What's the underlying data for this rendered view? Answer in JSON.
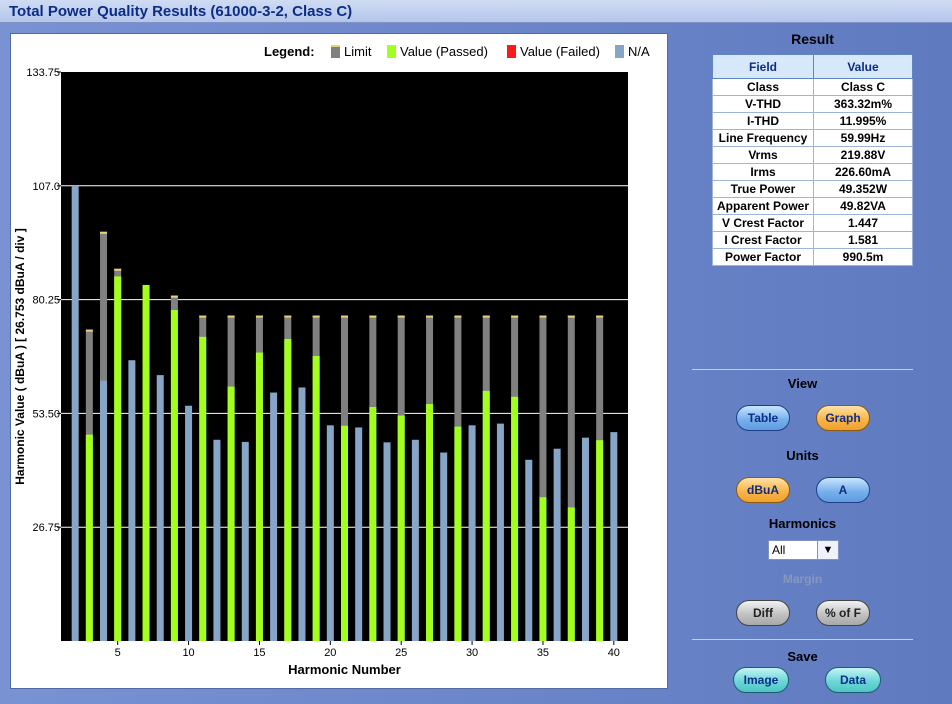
{
  "window": {
    "title": "Total Power Quality Results (61000-3-2, Class C)"
  },
  "chart_data": {
    "type": "bar",
    "title": "",
    "xlabel": "Harmonic Number",
    "ylabel": "Harmonic Value ( dBuA ) [ 26.753 dBuA / div ]",
    "ylim": [
      0,
      133.75
    ],
    "yticks": [
      26.75,
      53.5,
      80.25,
      107.0,
      133.75
    ],
    "ytick_labels": [
      "26.75",
      "53.50",
      "80.25",
      "107.0",
      "133.75"
    ],
    "xticks": [
      5,
      10,
      15,
      20,
      25,
      30,
      35,
      40
    ],
    "xlim": [
      1,
      41
    ],
    "grid": "horizontal",
    "legend_position": "top",
    "legend": {
      "title": "Legend:",
      "items": [
        {
          "name": "Limit",
          "color": "#808080"
        },
        {
          "name": "Value (Passed)",
          "color": "#a3ff1e"
        },
        {
          "name": "Value (Failed)",
          "color": "#ff1a1a"
        },
        {
          "name": "N/A",
          "color": "#87a6c7"
        }
      ]
    },
    "series": [
      {
        "name": "Limit",
        "x": [
          3,
          4,
          5,
          6,
          7,
          8,
          9,
          10,
          11,
          12,
          13,
          14,
          15,
          16,
          17,
          18,
          19,
          20,
          21,
          22,
          23,
          24,
          25,
          26,
          27,
          28,
          29,
          30,
          31,
          32,
          33,
          34,
          35,
          36,
          37,
          38,
          39,
          40
        ],
        "values": [
          73.2,
          96.2,
          87.5,
          null,
          null,
          null,
          81.2,
          null,
          76.5,
          null,
          76.5,
          null,
          76.5,
          null,
          76.5,
          null,
          76.5,
          null,
          76.5,
          null,
          76.5,
          null,
          76.5,
          null,
          76.5,
          null,
          76.5,
          null,
          76.5,
          null,
          76.5,
          null,
          76.5,
          null,
          76.5,
          null,
          76.5,
          null
        ]
      },
      {
        "name": "Value (Passed)",
        "x": [
          3,
          5,
          7,
          9,
          11,
          13,
          15,
          17,
          19,
          21,
          23,
          25,
          27,
          29,
          31,
          33,
          35,
          37,
          39
        ],
        "values": [
          48.5,
          85.7,
          83.7,
          77.8,
          71.5,
          59.8,
          67.8,
          71.0,
          67.0,
          50.6,
          55.0,
          53.0,
          55.7,
          50.4,
          58.8,
          57.4,
          33.8,
          31.4,
          47.2
        ]
      },
      {
        "name": "Value (Failed)",
        "x": [],
        "values": []
      },
      {
        "name": "N/A",
        "x": [
          2,
          4,
          6,
          8,
          10,
          12,
          14,
          16,
          18,
          20,
          22,
          24,
          26,
          28,
          30,
          32,
          34,
          36,
          38,
          40
        ],
        "values": [
          107.0,
          61.2,
          66.0,
          62.5,
          55.3,
          47.3,
          46.8,
          58.4,
          59.6,
          50.7,
          50.2,
          46.7,
          47.3,
          44.3,
          50.7,
          51.1,
          42.6,
          45.2,
          47.8,
          49.1
        ]
      }
    ]
  },
  "result": {
    "title": "Result",
    "columns": [
      "Field",
      "Value"
    ],
    "rows": [
      [
        "Class",
        "Class C"
      ],
      [
        "V-THD",
        "363.32m%"
      ],
      [
        "I-THD",
        "11.995%"
      ],
      [
        "Line Frequency",
        "59.99Hz"
      ],
      [
        "Vrms",
        "219.88V"
      ],
      [
        "Irms",
        "226.60mA"
      ],
      [
        "True Power",
        "49.352W"
      ],
      [
        "Apparent Power",
        "49.82VA"
      ],
      [
        "V Crest Factor",
        "1.447"
      ],
      [
        "I Crest Factor",
        "1.581"
      ],
      [
        "Power Factor",
        "990.5m"
      ]
    ]
  },
  "view": {
    "label": "View",
    "table_label": "Table",
    "graph_label": "Graph",
    "active": "Graph"
  },
  "units": {
    "label": "Units",
    "dbua_label": "dBuA",
    "a_label": "A",
    "active": "dBuA"
  },
  "harmonics": {
    "label": "Harmonics",
    "selected": "All"
  },
  "margin": {
    "label": "Margin",
    "diff_label": "Diff",
    "pct_label": "% of F"
  },
  "save": {
    "label": "Save",
    "image_label": "Image",
    "data_label": "Data"
  },
  "colors": {
    "active_button": "#f9b54a",
    "inactive_button": "#78b2ec",
    "save_button": "#6cd7d8",
    "plot_background": "#000000"
  }
}
